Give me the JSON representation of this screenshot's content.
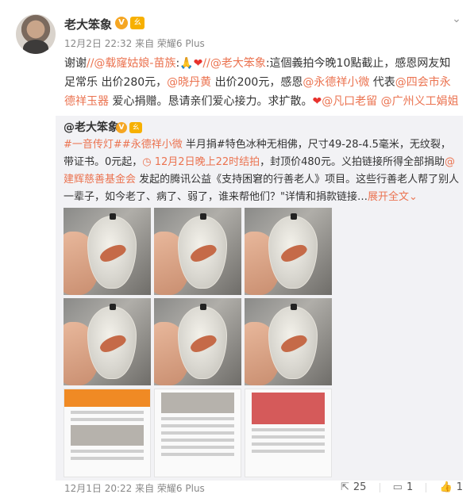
{
  "post": {
    "author": "老大笨象",
    "verified_badge": "V",
    "level_badge": "ㄠ",
    "meta": "12月2日 22:32 来自 荣耀6 Plus",
    "more_icon": "chevron-down-icon",
    "text": {
      "p1": "谢谢",
      "m1": "//@载窿姑娘-苗族",
      "p2": ":",
      "e1": "🙏",
      "e2": "❤",
      "m2": "//@老大笨象",
      "p3": ":這個義拍今晚10點截止，感恩网友知足常乐 出价280元，",
      "m3": "@晓丹黄",
      "p4": " 出价200元，感恩",
      "m4": "@永德祥小微",
      "p5": " 代表",
      "m5": "@四会市永德祥玉器",
      "p6": " 爱心捐赠。恳请亲们爱心接力。求扩散。",
      "e3": "❤",
      "m6": "@凡口老留",
      "m7": "@广州义工娟姐"
    }
  },
  "repost": {
    "author": "@老大笨象",
    "verified_badge": "V",
    "level_badge": "ㄠ",
    "text": {
      "t1": "#一音传灯#",
      "t2": "#永德祥小微",
      "p1": " 半月捐#特色冰种无相佛，尺寸49-28-4.5毫米，无纹裂，带证书。0元起，",
      "t3": "12月2日晚上22时结拍",
      "p2": "，封顶价480元。义拍链接所得全部捐助",
      "m1": "@建辉慈善基金会",
      "p3": " 发起的腾讯公益《支持困窘的行善老人》项目。这些行善老人帮了别人一辈子，如今老了、病了、弱了，谁来帮他们？\"详情和捐款链接…",
      "expand": "展开全文",
      "expand_icon": "chevron-down-icon"
    }
  },
  "footer": {
    "time": "12月1日 20:22 来自 荣耀6 Plus",
    "share_count": "25",
    "comment_count": "1",
    "like_count": "1"
  }
}
